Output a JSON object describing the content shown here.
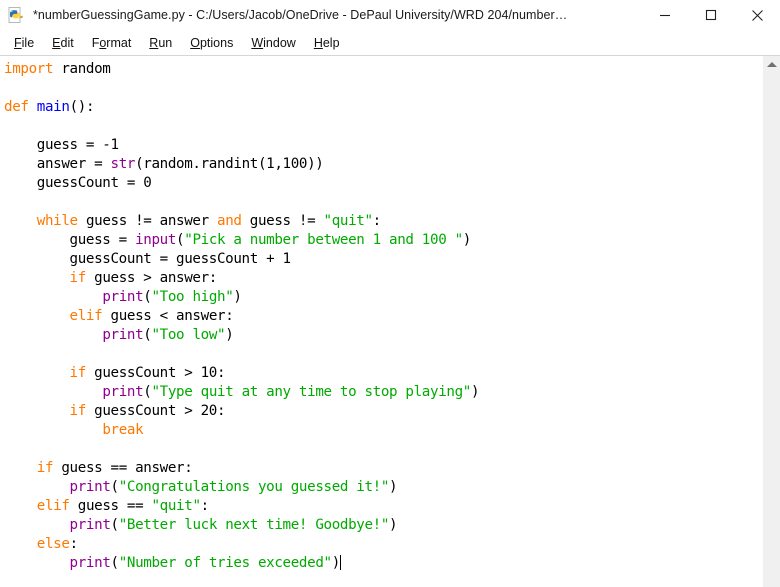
{
  "window": {
    "title": "*numberGuessingGame.py - C:/Users/Jacob/OneDrive - DePaul University/WRD 204/number…",
    "icon": "python-file-icon",
    "controls": {
      "minimize_label": "Minimize",
      "maximize_label": "Maximize",
      "close_label": "Close"
    }
  },
  "menubar": {
    "items": [
      {
        "label": "File",
        "mnemonic": "F"
      },
      {
        "label": "Edit",
        "mnemonic": "E"
      },
      {
        "label": "Format",
        "mnemonic": "o"
      },
      {
        "label": "Run",
        "mnemonic": "R"
      },
      {
        "label": "Options",
        "mnemonic": "O"
      },
      {
        "label": "Window",
        "mnemonic": "W"
      },
      {
        "label": "Help",
        "mnemonic": "H"
      }
    ]
  },
  "colors": {
    "keyword": "#ff7700",
    "builtin": "#900090",
    "definition": "#0000ff",
    "string": "#00aa00",
    "plain": "#000000",
    "background": "#ffffff",
    "titlebar": "#ffffff",
    "scrollbar_track": "#f0f0f0",
    "scrollbar_arrow": "#707070"
  },
  "editor": {
    "filename": "numberGuessingGame.py",
    "modified": true,
    "caret_line": 22,
    "caret_after": "print(\"Number of tries exceeded\")",
    "lines": [
      [
        [
          "import",
          "keyword"
        ],
        [
          " random",
          "plain"
        ]
      ],
      [],
      [
        [
          "def",
          "keyword"
        ],
        [
          " ",
          "plain"
        ],
        [
          "main",
          "definition"
        ],
        [
          "():",
          "plain"
        ]
      ],
      [],
      [
        [
          "    guess = -1",
          "plain"
        ]
      ],
      [
        [
          "    answer = ",
          "plain"
        ],
        [
          "str",
          "builtin"
        ],
        [
          "(random.randint(1,100))",
          "plain"
        ]
      ],
      [
        [
          "    guessCount = 0",
          "plain"
        ]
      ],
      [],
      [
        [
          "    ",
          "plain"
        ],
        [
          "while",
          "keyword"
        ],
        [
          " guess != answer ",
          "plain"
        ],
        [
          "and",
          "keyword"
        ],
        [
          " guess != ",
          "plain"
        ],
        [
          "\"quit\"",
          "string"
        ],
        [
          ":",
          "plain"
        ]
      ],
      [
        [
          "        guess = ",
          "plain"
        ],
        [
          "input",
          "builtin"
        ],
        [
          "(",
          "plain"
        ],
        [
          "\"Pick a number between 1 and 100 \"",
          "string"
        ],
        [
          ")",
          "plain"
        ]
      ],
      [
        [
          "        guessCount = guessCount + 1",
          "plain"
        ]
      ],
      [
        [
          "        ",
          "plain"
        ],
        [
          "if",
          "keyword"
        ],
        [
          " guess > answer:",
          "plain"
        ]
      ],
      [
        [
          "            ",
          "plain"
        ],
        [
          "print",
          "builtin"
        ],
        [
          "(",
          "plain"
        ],
        [
          "\"Too high\"",
          "string"
        ],
        [
          ")",
          "plain"
        ]
      ],
      [
        [
          "        ",
          "plain"
        ],
        [
          "elif",
          "keyword"
        ],
        [
          " guess < answer:",
          "plain"
        ]
      ],
      [
        [
          "            ",
          "plain"
        ],
        [
          "print",
          "builtin"
        ],
        [
          "(",
          "plain"
        ],
        [
          "\"Too low\"",
          "string"
        ],
        [
          ")",
          "plain"
        ]
      ],
      [],
      [
        [
          "        ",
          "plain"
        ],
        [
          "if",
          "keyword"
        ],
        [
          " guessCount > 10:",
          "plain"
        ]
      ],
      [
        [
          "            ",
          "plain"
        ],
        [
          "print",
          "builtin"
        ],
        [
          "(",
          "plain"
        ],
        [
          "\"Type quit at any time to stop playing\"",
          "string"
        ],
        [
          ")",
          "plain"
        ]
      ],
      [
        [
          "        ",
          "plain"
        ],
        [
          "if",
          "keyword"
        ],
        [
          " guessCount > 20:",
          "plain"
        ]
      ],
      [
        [
          "            ",
          "plain"
        ],
        [
          "break",
          "keyword"
        ]
      ],
      [],
      [
        [
          "    ",
          "plain"
        ],
        [
          "if",
          "keyword"
        ],
        [
          " guess == answer:",
          "plain"
        ]
      ],
      [
        [
          "        ",
          "plain"
        ],
        [
          "print",
          "builtin"
        ],
        [
          "(",
          "plain"
        ],
        [
          "\"Congratulations you guessed it!\"",
          "string"
        ],
        [
          ")",
          "plain"
        ]
      ],
      [
        [
          "    ",
          "plain"
        ],
        [
          "elif",
          "keyword"
        ],
        [
          " guess == ",
          "plain"
        ],
        [
          "\"quit\"",
          "string"
        ],
        [
          ":",
          "plain"
        ]
      ],
      [
        [
          "        ",
          "plain"
        ],
        [
          "print",
          "builtin"
        ],
        [
          "(",
          "plain"
        ],
        [
          "\"Better luck next time! Goodbye!\"",
          "string"
        ],
        [
          ")",
          "plain"
        ]
      ],
      [
        [
          "    ",
          "plain"
        ],
        [
          "else",
          "keyword"
        ],
        [
          ":",
          "plain"
        ]
      ],
      [
        [
          "        ",
          "plain"
        ],
        [
          "print",
          "builtin"
        ],
        [
          "(",
          "plain"
        ],
        [
          "\"Number of tries exceeded\"",
          "string"
        ],
        [
          ")",
          "plain"
        ],
        [
          "",
          "caret"
        ]
      ]
    ]
  },
  "scrollbar": {
    "up_arrow": "triangle-up-icon",
    "position": "top"
  }
}
